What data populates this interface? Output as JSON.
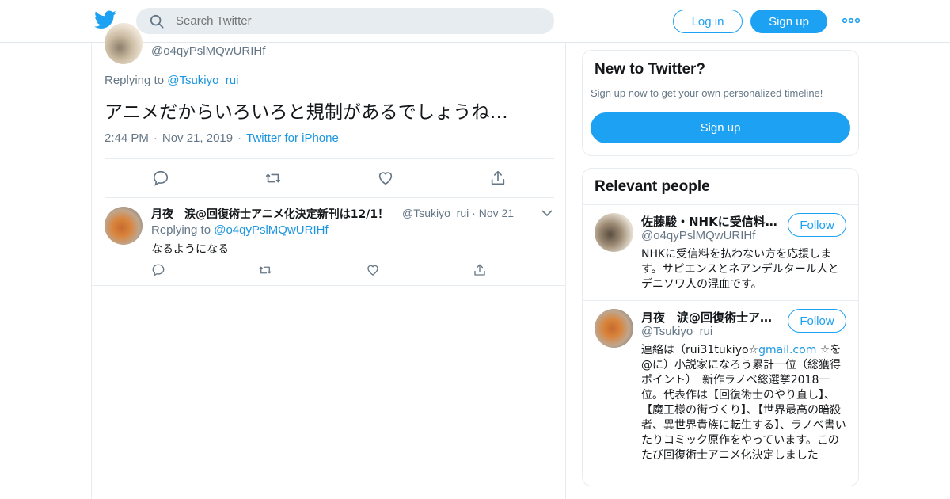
{
  "header": {
    "search_placeholder": "Search Twitter",
    "login_label": "Log in",
    "signup_label": "Sign up",
    "accent": "#1da1f2"
  },
  "focus_tweet": {
    "handle": "@o4qyPslMQwURIHf",
    "replying_prefix": "Replying to",
    "replying_to": "@Tsukiyo_rui",
    "text": "アニメだからいろいろと規制があるでしょうね…",
    "time": "2:44 PM",
    "date": "Nov 21, 2019",
    "source": "Twitter for iPhone"
  },
  "reply_tweet": {
    "name": "月夜　涙@回復術士アニメ化決定新刊は12/1！",
    "handle": "@Tsukiyo_rui",
    "date": "Nov 21",
    "replying_prefix": "Replying to",
    "replying_to": "@o4qyPslMQwURIHf",
    "text": "なるようになる"
  },
  "sidebar": {
    "new_title": "New to Twitter?",
    "new_subtitle": "Sign up now to get your own personalized timeline!",
    "new_signup": "Sign up",
    "people_title": "Relevant people",
    "people": [
      {
        "name": "佐藤駿・NHKに受信料…",
        "handle": "@o4qyPslMQwURIHf",
        "follow": "Follow",
        "bio": "NHKに受信料を払わない方を応援します。サピエンスとネアンデルタール人とデニソワ人の混血です。"
      },
      {
        "name": "月夜　涙@回復術士ア…",
        "handle": "@Tsukiyo_rui",
        "follow": "Follow",
        "bio_a": "連絡は（rui31tukiyo☆",
        "bio_link": "gmail.com",
        "bio_b": " ☆を@に）小説家になろう累計一位（総獲得ポイント）　新作ラノベ総選挙2018一位。代表作は【回復術士のやり直し】、【魔王様の街づくり】、【世界最高の暗殺者、異世界貴族に転生する】、ラノベ書いたりコミック原作をやっています。このたび回復術士アニメ化決定しました"
      }
    ]
  }
}
